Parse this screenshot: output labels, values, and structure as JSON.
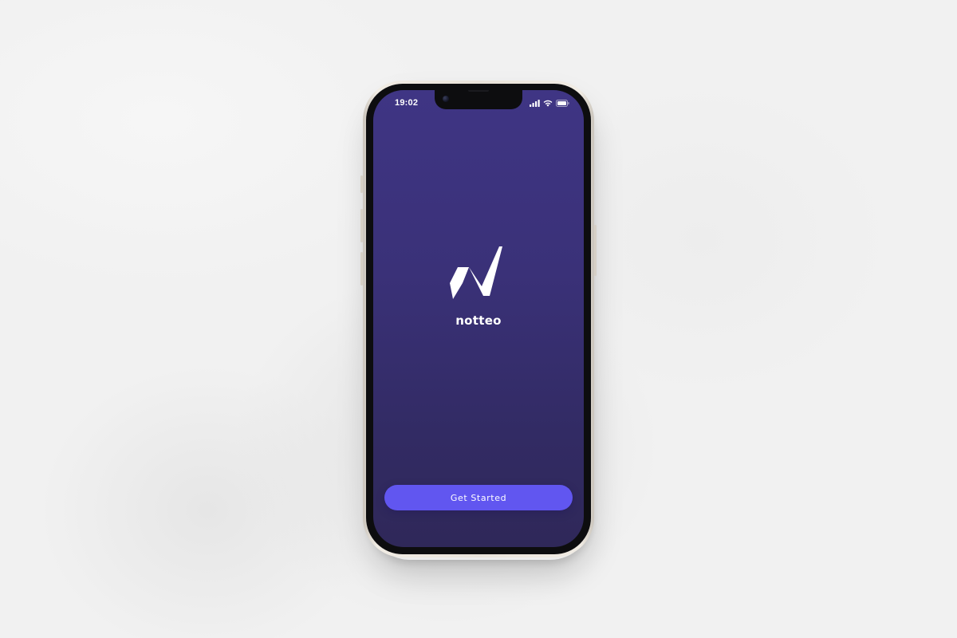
{
  "status_bar": {
    "time": "19:02",
    "icons": [
      "signal-icon",
      "wifi-icon",
      "battery-icon"
    ]
  },
  "app": {
    "name": "notteo",
    "logo_icon": "notteo-logo-icon"
  },
  "actions": {
    "get_started_label": "Get Started"
  },
  "colors": {
    "screen_top": "#3f3584",
    "screen_bottom": "#2f2859",
    "button": "#6156f0",
    "text": "#ffffff",
    "phone_frame": "#ece6dd",
    "background": "#f1f1f1"
  }
}
